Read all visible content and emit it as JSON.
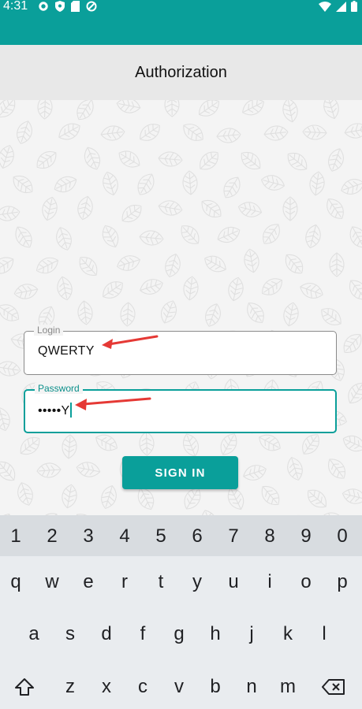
{
  "status_bar": {
    "time": "4:31",
    "left_icons": [
      "settings-icon",
      "shield-icon",
      "sd-card-icon",
      "at-sign-icon"
    ],
    "right_icons": [
      "wifi-icon",
      "cellular-signal-icon",
      "battery-icon"
    ]
  },
  "app_bar": {
    "title": "Authorization"
  },
  "form": {
    "login": {
      "label": "Login",
      "value": "QWERTY"
    },
    "password": {
      "label": "Password",
      "value": "•••••Y"
    },
    "signin_label": "SIGN IN"
  },
  "annotations": [
    "red-arrow-pointing-to-login-value",
    "red-arrow-pointing-to-password-value"
  ],
  "keyboard": {
    "number_row": [
      "1",
      "2",
      "3",
      "4",
      "5",
      "6",
      "7",
      "8",
      "9",
      "0"
    ],
    "row1": [
      "q",
      "w",
      "e",
      "r",
      "t",
      "y",
      "u",
      "i",
      "o",
      "p"
    ],
    "row2": [
      "a",
      "s",
      "d",
      "f",
      "g",
      "h",
      "j",
      "k",
      "l"
    ],
    "row3": [
      "z",
      "x",
      "c",
      "v",
      "b",
      "n",
      "m"
    ],
    "shift_icon": "shift-icon",
    "backspace_icon": "backspace-icon"
  },
  "colors": {
    "accent": "#0a9f9a",
    "annotation": "#e53935"
  }
}
